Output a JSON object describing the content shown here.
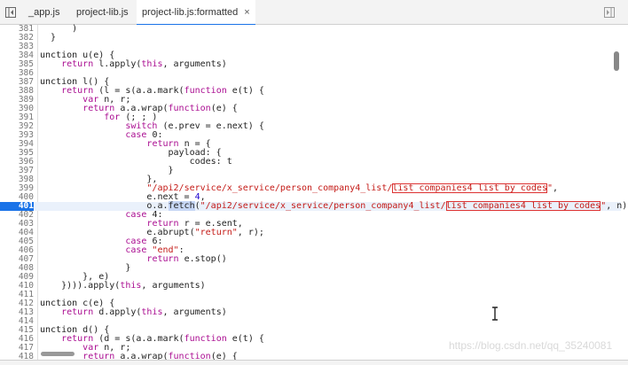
{
  "tabs": [
    {
      "label": "_app.js",
      "active": false
    },
    {
      "label": "project-lib.js",
      "active": false
    },
    {
      "label": "project-lib.js:formatted",
      "active": true,
      "close": "×"
    }
  ],
  "icons": {
    "nav_left": "panel-left-icon",
    "nav_right": "panel-right-icon"
  },
  "active_line": 401,
  "watermark": "https://blog.csdn.net/qq_35240081",
  "lines": [
    {
      "n": "381",
      "code": "      )"
    },
    {
      "n": "382",
      "code": "  }"
    },
    {
      "n": "383",
      "code": ""
    },
    {
      "n": "384",
      "code": "unction u(e) {"
    },
    {
      "n": "385",
      "code": "    return l.apply(this, arguments)"
    },
    {
      "n": "386",
      "code": ""
    },
    {
      "n": "387",
      "code": "unction l() {"
    },
    {
      "n": "388",
      "code": "    return (l = s(a.a.mark(function e(t) {"
    },
    {
      "n": "389",
      "code": "        var n, r;"
    },
    {
      "n": "390",
      "code": "        return a.a.wrap(function(e) {"
    },
    {
      "n": "391",
      "code": "            for (; ; )"
    },
    {
      "n": "392",
      "code": "                switch (e.prev = e.next) {"
    },
    {
      "n": "393",
      "code": "                case 0:"
    },
    {
      "n": "394",
      "code": "                    return n = {"
    },
    {
      "n": "395",
      "code": "                        payload: {"
    },
    {
      "n": "396",
      "code": "                            codes: t"
    },
    {
      "n": "397",
      "code": "                        }"
    },
    {
      "n": "398",
      "code": "                    },"
    },
    {
      "n": "399",
      "code": "                    \"/api2/service/x_service/person_company4_list/list_companies4_list_by_codes\","
    },
    {
      "n": "400",
      "code": "                    e.next = 4,"
    },
    {
      "n": "401",
      "code": "                    o.a.fetch(\"/api2/service/x_service/person_company4_list/list_companies4_list_by_codes\", n);"
    },
    {
      "n": "402",
      "code": "                case 4:"
    },
    {
      "n": "403",
      "code": "                    return r = e.sent,"
    },
    {
      "n": "404",
      "code": "                    e.abrupt(\"return\", r);"
    },
    {
      "n": "405",
      "code": "                case 6:"
    },
    {
      "n": "406",
      "code": "                case \"end\":"
    },
    {
      "n": "407",
      "code": "                    return e.stop()"
    },
    {
      "n": "408",
      "code": "                }"
    },
    {
      "n": "409",
      "code": "        }, e)"
    },
    {
      "n": "410",
      "code": "    }))).apply(this, arguments)"
    },
    {
      "n": "411",
      "code": ""
    },
    {
      "n": "412",
      "code": "unction c(e) {"
    },
    {
      "n": "413",
      "code": "    return d.apply(this, arguments)"
    },
    {
      "n": "414",
      "code": ""
    },
    {
      "n": "415",
      "code": "unction d() {"
    },
    {
      "n": "416",
      "code": "    return (d = s(a.a.mark(function e(t) {"
    },
    {
      "n": "417",
      "code": "        var n, r;"
    },
    {
      "n": "418",
      "code": "        return a.a.wrap(function(e) {"
    }
  ]
}
